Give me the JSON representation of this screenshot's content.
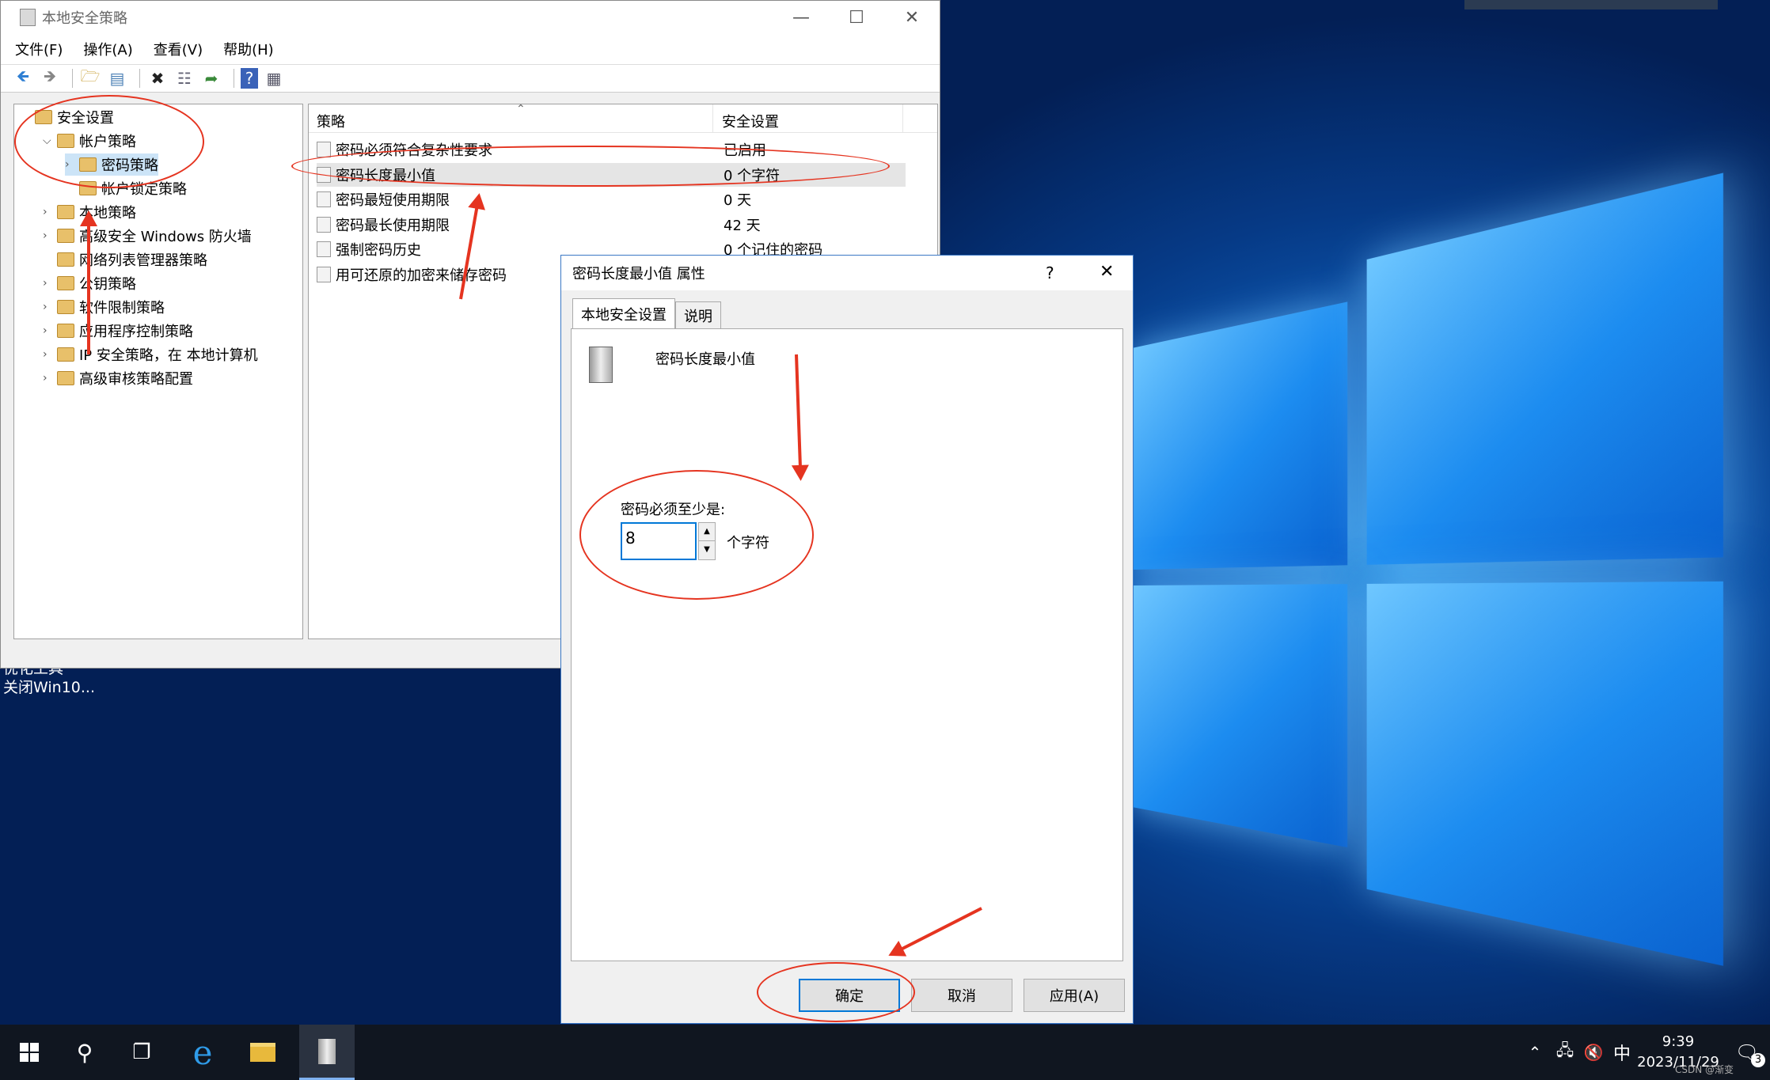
{
  "main_window": {
    "title": "本地安全策略",
    "menu": [
      "文件(F)",
      "操作(A)",
      "查看(V)",
      "帮助(H)"
    ],
    "tree": [
      {
        "label": "安全设置",
        "level": 0,
        "expander": ""
      },
      {
        "label": "帐户策略",
        "level": 1,
        "expander": "v"
      },
      {
        "label": "密码策略",
        "level": 2,
        "expander": ">",
        "selected": true
      },
      {
        "label": "帐户锁定策略",
        "level": 2,
        "expander": ""
      },
      {
        "label": "本地策略",
        "level": 1,
        "expander": ">"
      },
      {
        "label": "高级安全 Windows 防火墙",
        "level": 1,
        "expander": ">"
      },
      {
        "label": "网络列表管理器策略",
        "level": 1,
        "expander": ""
      },
      {
        "label": "公钥策略",
        "level": 1,
        "expander": ">"
      },
      {
        "label": "软件限制策略",
        "level": 1,
        "expander": ">"
      },
      {
        "label": "应用程序控制策略",
        "level": 1,
        "expander": ">"
      },
      {
        "label": "IP 安全策略，在 本地计算机",
        "level": 1,
        "expander": ">"
      },
      {
        "label": "高级审核策略配置",
        "level": 1,
        "expander": ">"
      }
    ],
    "list_headers": {
      "policy": "策略",
      "setting": "安全设置"
    },
    "policies": [
      {
        "name": "密码必须符合复杂性要求",
        "value": "已启用"
      },
      {
        "name": "密码长度最小值",
        "value": "0 个字符",
        "selected": true
      },
      {
        "name": "密码最短使用期限",
        "value": "0 天"
      },
      {
        "name": "密码最长使用期限",
        "value": "42 天"
      },
      {
        "name": "强制密码历史",
        "value": "0 个记住的密码"
      },
      {
        "name": "用可还原的加密来储存密码",
        "value": ""
      }
    ]
  },
  "desktop": {
    "icon_label_1": "优化工具",
    "icon_label_2": "关闭Win10..."
  },
  "dialog": {
    "title": "密码长度最小值 属性",
    "help": "?",
    "tabs": [
      "本地安全设置",
      "说明"
    ],
    "policy_name": "密码长度最小值",
    "field_label": "密码必须至少是:",
    "value": "8",
    "unit": "个字符",
    "buttons": {
      "ok": "确定",
      "cancel": "取消",
      "apply": "应用(A)"
    }
  },
  "taskbar": {
    "ime": "中",
    "time": "9:39",
    "date": "2023/11/29",
    "notification_count": "3",
    "watermark": "CSDN @渐变"
  },
  "colors": {
    "annotation": "#e53420",
    "accent": "#0078d7"
  }
}
